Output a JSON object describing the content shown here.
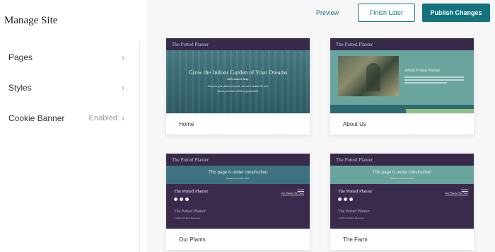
{
  "sidebar": {
    "title": "Manage Site",
    "items": [
      {
        "label": "Pages",
        "status": ""
      },
      {
        "label": "Styles",
        "status": ""
      },
      {
        "label": "Cookie Banner",
        "status": "Enabled"
      }
    ]
  },
  "header": {
    "preview_label": "Preview",
    "finish_later_label": "Finish Later",
    "publish_label": "Publish Changes"
  },
  "colors": {
    "accent": "#12727e",
    "purple_nav": "#382a4a",
    "teal_hero": "#3f6f78"
  },
  "site_name": "The Potted Planter",
  "cards": [
    {
      "label": "Home",
      "hero_title": "Grow the Indoor Garden of Your Dreams",
      "hero_line1": "We'll make it easy.",
      "hero_line2": "Just pick your plants and pots, and we'll handle the rest.",
      "hero_line3": "Speedy and safe delivery guaranteed."
    },
    {
      "label": "About Us",
      "about_title": "About Potted Planter"
    },
    {
      "label": "Our Plants",
      "uc_title": "This page is under construction",
      "uc_sub": "Please come back soon!",
      "footer_brand": "The Potted Planter",
      "link1": "Home",
      "link2": "Our Plants",
      "link3": "The Farm",
      "footer_brand2": "The Potted Planter",
      "copyright": "© 2020 All Rights Reserved"
    },
    {
      "label": "The Farm",
      "uc_title": "This page is under construction",
      "uc_sub": "Please come back soon!",
      "footer_brand": "The Potted Planter",
      "link1": "Home",
      "link2": "Our Plants",
      "link3": "The Farm",
      "footer_brand2": "The Potted Planter",
      "copyright": "© 2020 All Rights Reserved"
    }
  ]
}
